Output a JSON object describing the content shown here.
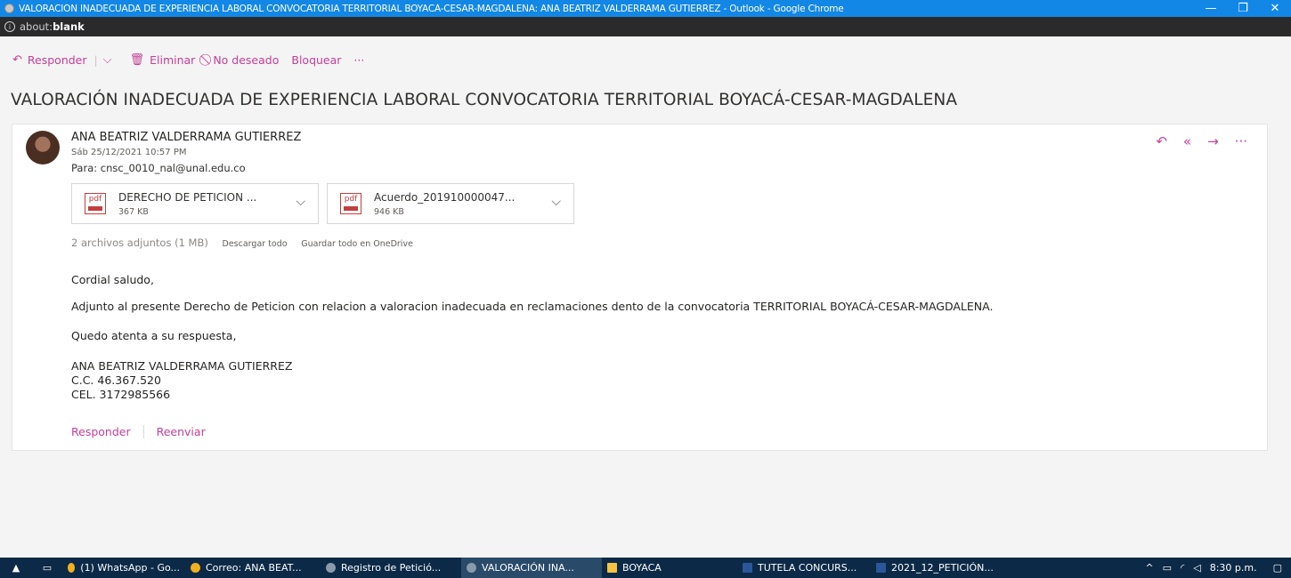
{
  "window": {
    "title": "VALORACIÓN INADECUADA DE EXPERIENCIA LABORAL CONVOCATORIA TERRITORIAL BOYACÁ-CESAR-MAGDALENA: ANA BEATRIZ VALDERRAMA GUTIERREZ - Outlook - Google Chrome",
    "address_prefix": "about:",
    "address_bold": "blank"
  },
  "toolbar": {
    "reply": "Responder",
    "delete": "Eliminar",
    "junk": "No deseado",
    "block": "Bloquear",
    "more": "···"
  },
  "message": {
    "subject": "VALORACIÓN INADECUADA DE EXPERIENCIA LABORAL CONVOCATORIA TERRITORIAL BOYACÁ-CESAR-MAGDALENA",
    "sender": "ANA BEATRIZ VALDERRAMA GUTIERREZ",
    "date": "Sáb 25/12/2021 10:57 PM",
    "to": "Para: cnsc_0010_nal@unal.edu.co",
    "attachments": [
      {
        "name": "DERECHO DE PETICION ...",
        "size": "367 KB",
        "type": "pdf"
      },
      {
        "name": "Acuerdo_201910000047...",
        "size": "946 KB",
        "type": "pdf"
      }
    ],
    "attachments_summary": "2 archivos adjuntos (1 MB)",
    "download_all": "Descargar todo",
    "save_onedrive": "Guardar todo en OneDrive",
    "body": {
      "greeting": "Cordial saludo,",
      "paragraph": "Adjunto al presente Derecho de Peticion con relacion a valoracion inadecuada en reclamaciones dento de la convocatoria TERRITORIAL BOYACÁ-CESAR-MAGDALENA.",
      "closing": "Quedo atenta a su respuesta,",
      "signature_name": "ANA BEATRIZ VALDERRAMA GUTIERREZ",
      "signature_id": "C.C. 46.367.520",
      "signature_phone": "CEL. 3172985566"
    },
    "reply_link": "Responder",
    "forward_link": "Reenviar"
  },
  "taskbar": {
    "items": [
      {
        "label": "(1) WhatsApp - Go...",
        "icon": "chrome-icon"
      },
      {
        "label": "Correo: ANA BEAT...",
        "icon": "chrome-icon"
      },
      {
        "label": "Registro de Petició...",
        "icon": "globe-icon"
      },
      {
        "label": "VALORACIÓN INA...",
        "icon": "globe-icon"
      },
      {
        "label": "BOYACA",
        "icon": "folder-icon"
      },
      {
        "label": "TUTELA CONCURS...",
        "icon": "word-icon"
      },
      {
        "label": "2021_12_PETICIÓN...",
        "icon": "word-icon"
      }
    ],
    "clock": "8:30 p.m."
  },
  "colors": {
    "accent": "#c43e98",
    "titlebar": "#1287e6",
    "taskbar": "#0c2a47"
  }
}
